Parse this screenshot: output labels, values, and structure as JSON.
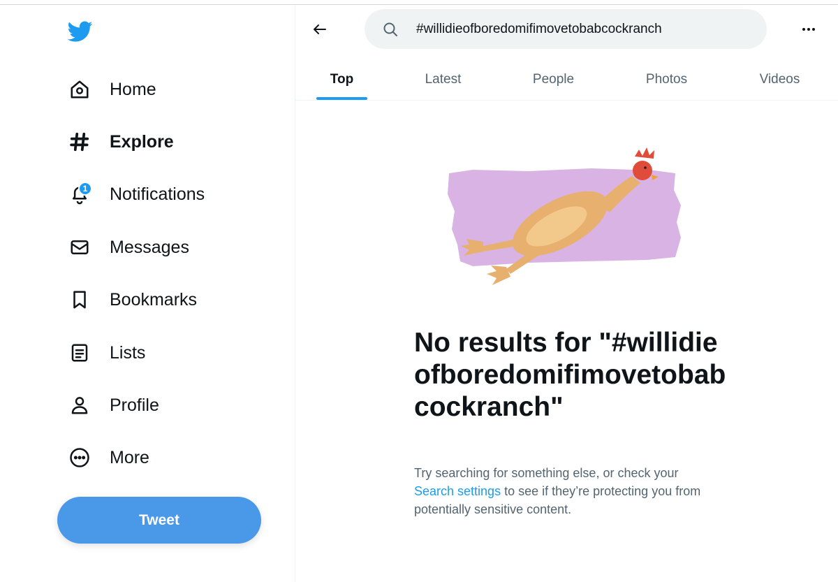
{
  "nav": {
    "items": [
      {
        "label": "Home",
        "icon": "home-icon"
      },
      {
        "label": "Explore",
        "icon": "hashtag-icon"
      },
      {
        "label": "Notifications",
        "icon": "bell-icon",
        "badge": "1"
      },
      {
        "label": "Messages",
        "icon": "envelope-icon"
      },
      {
        "label": "Bookmarks",
        "icon": "bookmark-icon"
      },
      {
        "label": "Lists",
        "icon": "list-icon"
      },
      {
        "label": "Profile",
        "icon": "person-icon"
      },
      {
        "label": "More",
        "icon": "more-circle-icon"
      }
    ],
    "active": "Explore",
    "tweet_label": "Tweet"
  },
  "search": {
    "value": "#willidieofboredomifimovetobabcockranch"
  },
  "tabs": [
    {
      "label": "Top"
    },
    {
      "label": "Latest"
    },
    {
      "label": "People"
    },
    {
      "label": "Photos"
    },
    {
      "label": "Videos"
    }
  ],
  "active_tab": "Top",
  "empty": {
    "title": "No results for \"#willidieofboredomifimovetobabcockranch\"",
    "sub_before": "Try searching for something else, or check your ",
    "sub_link": "Search settings",
    "sub_after": " to see if they’re protecting you from potentially sensitive content."
  },
  "colors": {
    "accent": "#1d9bf0",
    "tweet_button": "#4a99e9",
    "illustration_bg": "#d9b3e3"
  }
}
